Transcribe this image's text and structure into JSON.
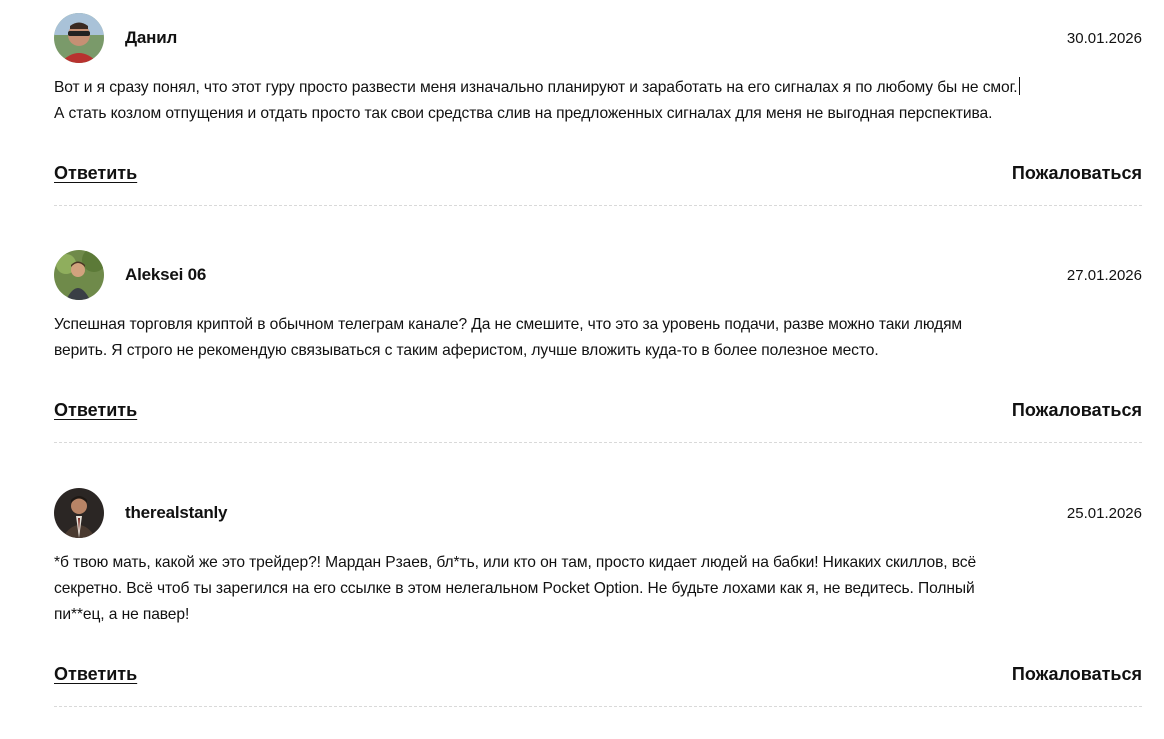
{
  "comments": [
    {
      "author": "Данил",
      "date": "30.01.2026",
      "avatar_icon": "user-avatar-photo",
      "text_lines": [
        "Вот и я сразу понял, что этот гуру просто развести меня изначально планируют и заработать на его сигналах я по любому бы не смог.",
        "А стать козлом отпущения и отдать просто так свои средства слив на предложенных сигналах для меня не выгодная перспектива."
      ],
      "reply_label": "Ответить",
      "report_label": "Пожаловаться"
    },
    {
      "author": "Aleksei 06",
      "date": "27.01.2026",
      "avatar_icon": "user-avatar-photo",
      "text_lines": [
        "Успешная торговля криптой в обычном телеграм канале? Да не смешите, что это за уровень подачи, разве можно таки людям",
        "верить. Я строго не рекомендую связываться с таким аферистом, лучше вложить куда-то в более полезное место."
      ],
      "reply_label": "Ответить",
      "report_label": "Пожаловаться"
    },
    {
      "author": "therealstanly",
      "date": "25.01.2026",
      "avatar_icon": "user-avatar-photo",
      "text_lines": [
        "*б твою мать, какой же это трейдер?! Мардан Рзаев, бл*ть, или кто он там, просто кидает людей на бабки! Никаких скиллов, всё",
        "секретно. Всё чтоб ты зарегился на его ссылке в этом нелегальном Pocket Option. Не будьте лохами как я, не ведитесь. Полный",
        "пи**ец, а не павер!"
      ],
      "reply_label": "Ответить",
      "report_label": "Пожаловаться"
    }
  ]
}
